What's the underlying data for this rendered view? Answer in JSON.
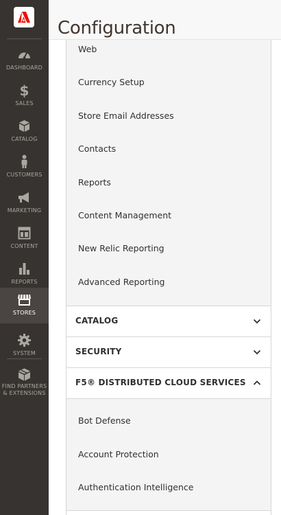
{
  "nav": {
    "items": [
      {
        "label": "Dashboard",
        "icon": "gauge-icon"
      },
      {
        "label": "Sales",
        "icon": "dollar-icon"
      },
      {
        "label": "Catalog",
        "icon": "box-icon"
      },
      {
        "label": "Customers",
        "icon": "person-icon"
      },
      {
        "label": "Marketing",
        "icon": "megaphone-icon"
      },
      {
        "label": "Content",
        "icon": "layout-icon"
      },
      {
        "label": "Reports",
        "icon": "bar-chart-icon"
      },
      {
        "label": "Stores",
        "icon": "storefront-icon",
        "active": true
      },
      {
        "label": "System",
        "icon": "gear-icon"
      },
      {
        "label": "Find Partners & Extensions",
        "icon": "cube-icon"
      }
    ],
    "colors": {
      "background": "#373330",
      "active": "#4a4542",
      "text": "#aaa6a0",
      "logo": "#eb1000"
    }
  },
  "header": {
    "title": "Configuration"
  },
  "general_items": [
    "Web",
    "Currency Setup",
    "Store Email Addresses",
    "Contacts",
    "Reports",
    "Content Management",
    "New Relic Reporting",
    "Advanced Reporting"
  ],
  "sections": [
    {
      "label": "Catalog",
      "state": "collapsed",
      "icon": "chevron-down-icon"
    },
    {
      "label": "Security",
      "state": "collapsed",
      "icon": "chevron-down-icon"
    },
    {
      "label": "F5® Distributed Cloud Services",
      "state": "expanded",
      "icon": "chevron-up-icon"
    }
  ],
  "f5_items": [
    "Bot Defense",
    "Account Protection",
    "Authentication Intelligence"
  ]
}
